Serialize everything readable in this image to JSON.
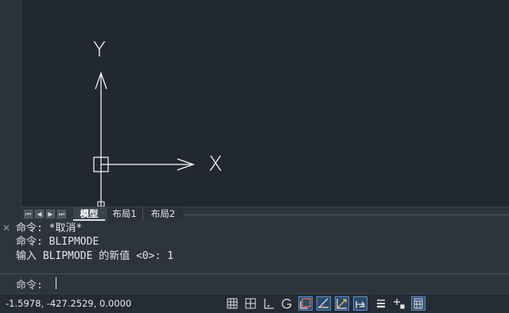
{
  "canvas": {
    "axis_x_label": "X",
    "axis_y_label": "Y"
  },
  "tabs": {
    "nav_first": "⏮",
    "nav_prev": "◀",
    "nav_next": "▶",
    "nav_last": "⏭",
    "items": [
      {
        "label": "模型",
        "active": true
      },
      {
        "label": "布局1",
        "active": false
      },
      {
        "label": "布局2",
        "active": false
      }
    ]
  },
  "command_window": {
    "close_glyph": "✕",
    "history": [
      "命令: *取消*",
      "命令: BLIPMODE",
      "输入 BLIPMODE 的新值 <0>: 1"
    ],
    "prompt": "命令:",
    "input_value": ""
  },
  "status_bar": {
    "coordinates": "-1.5978, -427.2529, 0.0000",
    "toggles": [
      {
        "name": "model-grid-icon",
        "on": false
      },
      {
        "name": "snap-grid-icon",
        "on": false
      },
      {
        "name": "infer-constraints-icon",
        "on": false
      },
      {
        "name": "polar-tracking-icon",
        "on": false
      },
      {
        "name": "object-snap-icon",
        "on": true
      },
      {
        "name": "isometric-drafting-icon",
        "on": true
      },
      {
        "name": "dynamic-ucs-icon",
        "on": true
      },
      {
        "name": "dynamic-input-icon",
        "on": true
      },
      {
        "name": "lineweight-icon",
        "on": false
      },
      {
        "name": "selection-cycling-icon",
        "on": false
      },
      {
        "name": "workspace-icon",
        "on": true
      }
    ]
  },
  "colors": {
    "canvas_bg": "#212830",
    "panel_bg": "#2d343c",
    "accent": "#5b8fc7"
  }
}
